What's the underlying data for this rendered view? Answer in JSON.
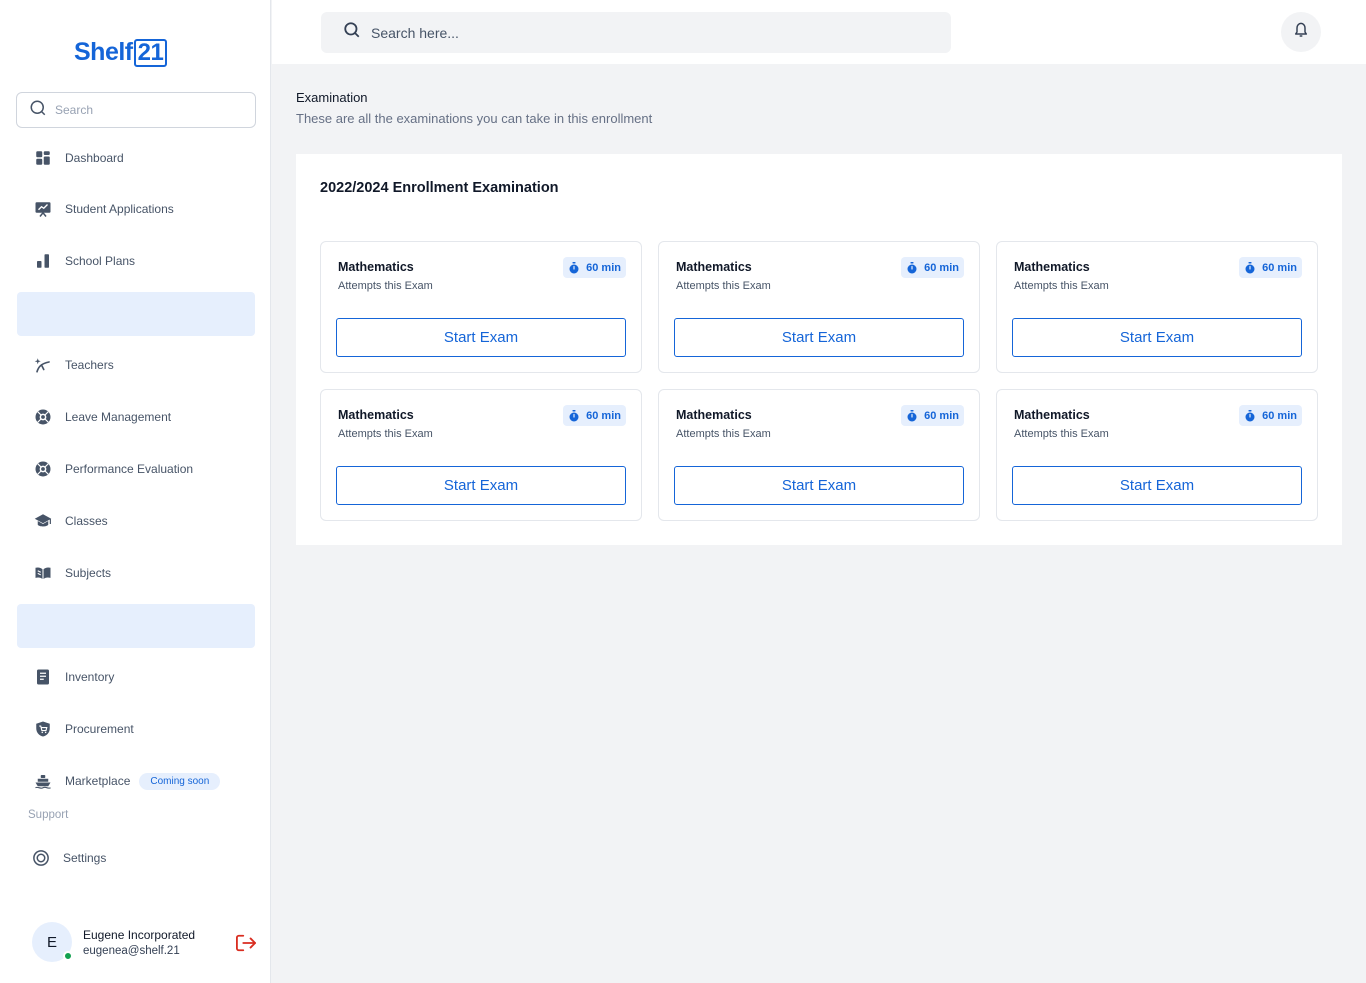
{
  "app": {
    "logo_text": "Shelf",
    "logo_box": "21"
  },
  "sidebar": {
    "search_placeholder": "Search",
    "items": [
      {
        "label": "Dashboard",
        "icon": "dashboard-icon"
      },
      {
        "label": "Student Applications",
        "icon": "presentation-chart-icon"
      },
      {
        "label": "School Plans",
        "icon": "bar-chart-icon"
      },
      {
        "label": "Teachers",
        "icon": "teacher-icon"
      },
      {
        "label": "Leave Management",
        "icon": "lifebuoy-icon"
      },
      {
        "label": "Performance Evaluation",
        "icon": "lifebuoy-icon"
      },
      {
        "label": "Classes",
        "icon": "graduation-cap-icon"
      },
      {
        "label": "Subjects",
        "icon": "book-icon"
      },
      {
        "label": "Inventory",
        "icon": "document-list-icon"
      },
      {
        "label": "Procurement",
        "icon": "shield-cart-icon"
      },
      {
        "label": "Marketplace",
        "icon": "ship-icon",
        "badge": "Coming soon"
      }
    ],
    "support_label": "Support",
    "settings_label": "Settings"
  },
  "user": {
    "initial": "E",
    "name": "Eugene Incorporated",
    "email": "eugenea@shelf.21",
    "status_color": "#12A150"
  },
  "topbar": {
    "search_placeholder": "Search here..."
  },
  "main": {
    "title": "Examination",
    "subtitle": "These are all the examinations you can take in this enrollment",
    "panel_title": "2022/2024 Enrollment Examination",
    "exams": [
      {
        "subject": "Mathematics",
        "attempts": "Attempts this Exam",
        "duration": "60 min",
        "button": "Start Exam"
      },
      {
        "subject": "Mathematics",
        "attempts": "Attempts this Exam",
        "duration": "60 min",
        "button": "Start Exam"
      },
      {
        "subject": "Mathematics",
        "attempts": "Attempts this Exam",
        "duration": "60 min",
        "button": "Start Exam"
      },
      {
        "subject": "Mathematics",
        "attempts": "Attempts this Exam",
        "duration": "60 min",
        "button": "Start Exam"
      },
      {
        "subject": "Mathematics",
        "attempts": "Attempts this Exam",
        "duration": "60 min",
        "button": "Start Exam"
      },
      {
        "subject": "Mathematics",
        "attempts": "Attempts this Exam",
        "duration": "60 min",
        "button": "Start Exam"
      }
    ]
  },
  "colors": {
    "brand": "#1565D8",
    "highlight": "#E6EFFD",
    "logout": "#D92D20"
  }
}
